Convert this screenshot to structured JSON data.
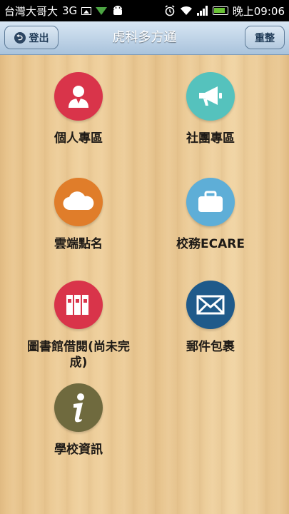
{
  "status_bar": {
    "carrier": "台灣大哥大",
    "network": "3G",
    "time": "晚上09:06"
  },
  "header": {
    "title": "虎科多方通",
    "logout_label": "登出",
    "reset_label": "重整"
  },
  "tiles": [
    {
      "label": "個人專區",
      "icon": "person-icon",
      "color": "#d9344a"
    },
    {
      "label": "社團專區",
      "icon": "megaphone-icon",
      "color": "#55c2bd"
    },
    {
      "label": "雲端點名",
      "icon": "cloud-icon",
      "color": "#e07d2a"
    },
    {
      "label": "校務ECARE",
      "icon": "briefcase-icon",
      "color": "#5eaed7"
    },
    {
      "label": "圖書館借閱(尚未完成)",
      "icon": "books-icon",
      "color": "#d9344a"
    },
    {
      "label": "郵件包裹",
      "icon": "mail-icon",
      "color": "#1f5a8a"
    },
    {
      "label": "學校資訊",
      "icon": "info-icon",
      "color": "#6f6a3e"
    }
  ]
}
